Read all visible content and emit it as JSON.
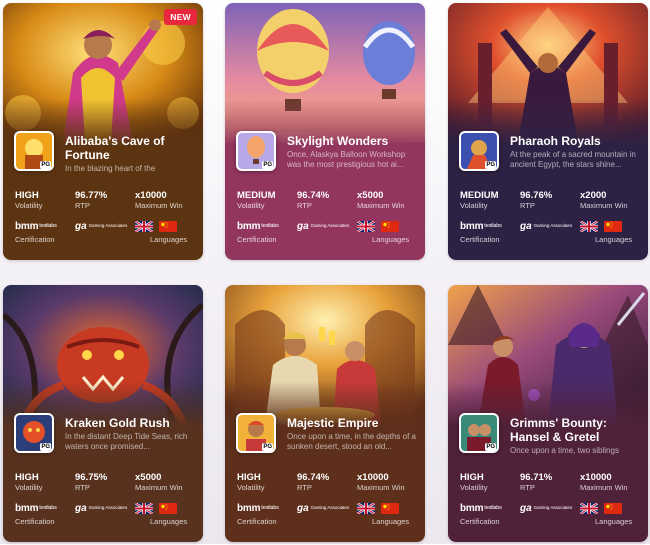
{
  "badges": {
    "new": "NEW"
  },
  "labels": {
    "volatility": "Volatility",
    "rtp": "RTP",
    "max_win": "Maximum Win",
    "certification": "Certification",
    "languages": "Languages",
    "bmm_logo": "bmm",
    "bmm_sub": "testlabs",
    "ga_logo": "ga",
    "ga_sub": "Gaming Associates",
    "pg_mark": "PG"
  },
  "games": [
    {
      "title": "Alibaba's Cave of Fortune",
      "description": "In the blazing heart of the",
      "volatility": "HIGH",
      "rtp": "96.77%",
      "max_win": "x10000",
      "badge": "NEW",
      "accent": "#f0a21a",
      "panel_color": "#5d3412"
    },
    {
      "title": "Skylight Wonders",
      "description": "Once, Alaskya Balloon Workshop was the most prestigious hot ai...",
      "volatility": "MEDIUM",
      "rtp": "96.74%",
      "max_win": "x5000",
      "badge": "",
      "accent": "#f5a46a",
      "panel_color": "#93365f"
    },
    {
      "title": "Pharaoh Royals",
      "description": "At the peak of a sacred mountain in ancient Egypt, the stars shine...",
      "volatility": "MEDIUM",
      "rtp": "96.76%",
      "max_win": "x2000",
      "badge": "",
      "accent": "#e0502c",
      "panel_color": "#2e2244"
    },
    {
      "title": "Kraken Gold Rush",
      "description": "In the distant Deep Tide Seas, rich waters once promised...",
      "volatility": "HIGH",
      "rtp": "96.75%",
      "max_win": "x5000",
      "badge": "",
      "accent": "#e4502a",
      "panel_color": "#58321f"
    },
    {
      "title": "Majestic Empire",
      "description": "Once upon a time, in the depths of a sunken desert, stood an old...",
      "volatility": "HIGH",
      "rtp": "96.74%",
      "max_win": "x10000",
      "badge": "",
      "accent": "#f2b23a",
      "panel_color": "#5e301c"
    },
    {
      "title": "Grimms' Bounty: Hansel & Gretel",
      "description": "Once upon a time, two siblings",
      "volatility": "HIGH",
      "rtp": "96.71%",
      "max_win": "x10000",
      "badge": "",
      "accent": "#9a4ad0",
      "panel_color": "#50223a"
    }
  ]
}
